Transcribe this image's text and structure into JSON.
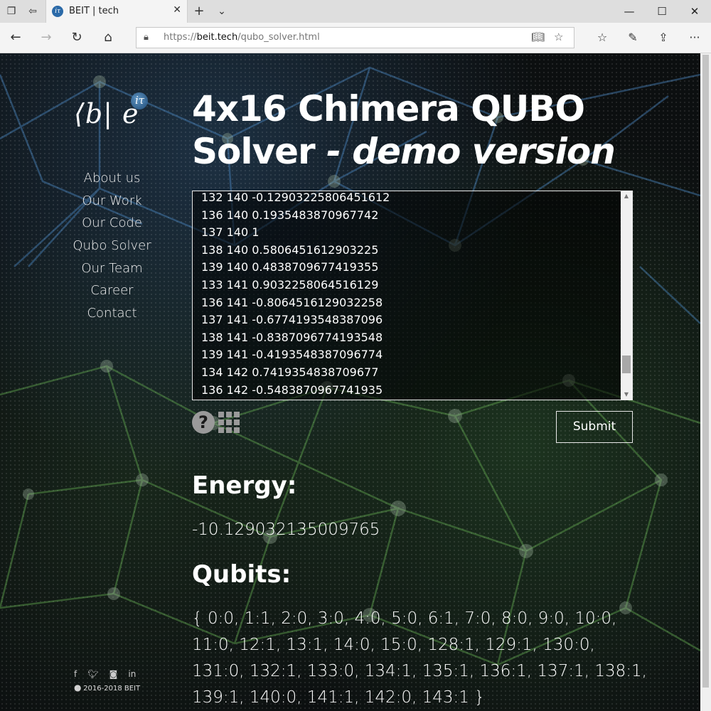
{
  "browser": {
    "tab_title": "BEIT | tech",
    "url_prefix": "https://",
    "url_host": "beit.tech",
    "url_path": "/qubo_solver.html",
    "more_label": "···"
  },
  "logo": {
    "text": "⟨b| e",
    "superscript": "iτ"
  },
  "sidebar": {
    "items": [
      {
        "label": "About us"
      },
      {
        "label": "Our Work"
      },
      {
        "label": "Our Code"
      },
      {
        "label": "Qubo Solver"
      },
      {
        "label": "Our Team"
      },
      {
        "label": "Career"
      },
      {
        "label": "Contact"
      }
    ],
    "social": [
      "f",
      "twitter",
      "instagram",
      "in",
      "github"
    ],
    "copyright": "© 2016-2018 BEIT"
  },
  "main": {
    "title": "4x16 Chimera QUBO Solver",
    "subtitle": " - demo version",
    "editor_lines": [
      "132 140 -0.12903225806451612",
      "136 140 0.1935483870967742",
      "137 140 1",
      "138 140 0.5806451612903225",
      "139 140 0.4838709677419355",
      "133 141 0.9032258064516129",
      "136 141 -0.8064516129032258",
      "137 141 -0.6774193548387096",
      "138 141 -0.8387096774193548",
      "139 141 -0.4193548387096774",
      "134 142 0.7419354838709677",
      "136 142 -0.5483870967741935"
    ],
    "help_label": "?",
    "submit_label": "Submit",
    "energy_heading": "Energy:",
    "energy_value": "-10.129032135009765",
    "qubits_heading": "Qubits:",
    "qubits_value": "{ 0:0, 1:1, 2:0, 3:0, 4:0, 5:0, 6:1, 7:0, 8:0, 9:0, 10:0, 11:0, 12:1, 13:1, 14:0, 15:0, 128:1, 129:1, 130:0, 131:0, 132:1, 133:0, 134:1, 135:1, 136:1, 137:1, 138:1, 139:1, 140:0, 141:1, 142:0, 143:1 }"
  },
  "colors": {
    "page_background": "#0c0f10",
    "text": "#ffffff",
    "network_blue": "#4a86c0",
    "network_green": "#5a9a4a"
  }
}
